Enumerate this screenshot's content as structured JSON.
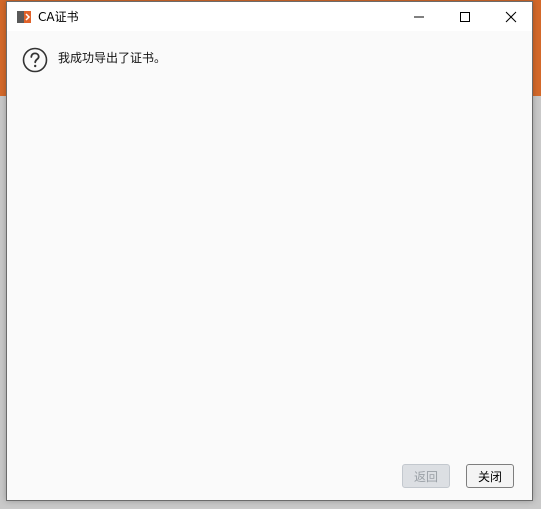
{
  "window": {
    "title": "CA证书",
    "app_icon": "app-logo-icon",
    "controls": {
      "minimize": "minimize-icon",
      "maximize": "maximize-icon",
      "close": "close-icon"
    }
  },
  "dialog": {
    "icon": "question-icon",
    "message": "我成功导出了证书。"
  },
  "buttons": {
    "back_label": "返回",
    "close_label": "关闭"
  },
  "colors": {
    "accent": "#d4692a",
    "background": "#fafafa"
  }
}
